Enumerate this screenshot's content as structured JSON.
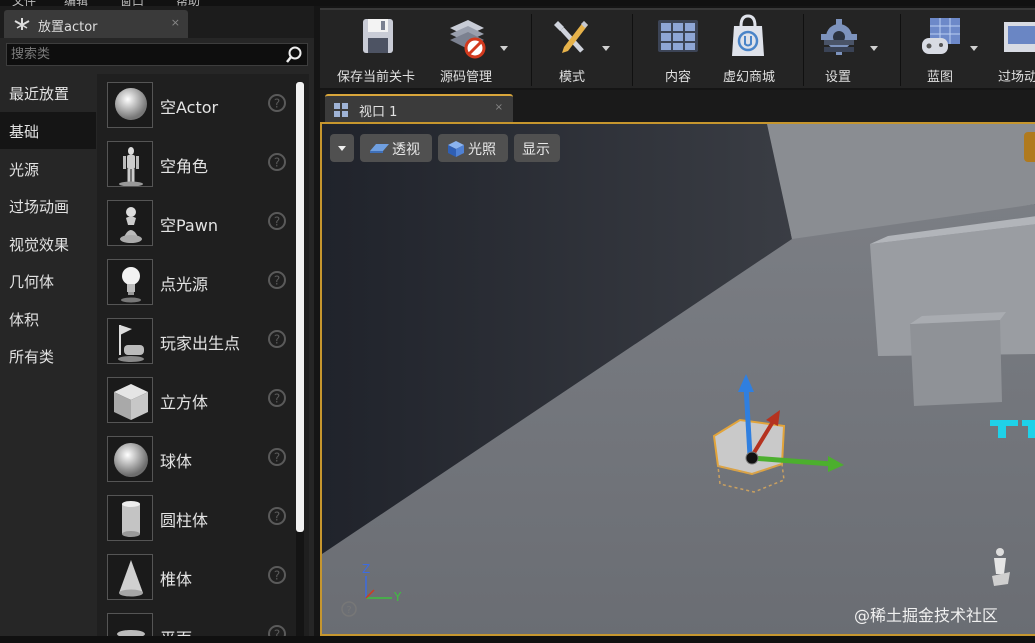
{
  "top_menu": [
    "文件",
    "编辑",
    "窗口",
    "帮助"
  ],
  "panel": {
    "title": "放置actor",
    "close": "×",
    "search_placeholder": "搜索类",
    "categories": [
      "最近放置",
      "基础",
      "光源",
      "过场动画",
      "视觉效果",
      "几何体",
      "体积",
      "所有类"
    ],
    "active_category": "基础",
    "items": [
      {
        "label": "空Actor",
        "icon": "sphere-icon"
      },
      {
        "label": "空角色",
        "icon": "character-icon"
      },
      {
        "label": "空Pawn",
        "icon": "pawn-icon"
      },
      {
        "label": "点光源",
        "icon": "light-bulb-icon"
      },
      {
        "label": "玩家出生点",
        "icon": "player-start-icon"
      },
      {
        "label": "立方体",
        "icon": "cube-icon"
      },
      {
        "label": "球体",
        "icon": "sphere-icon"
      },
      {
        "label": "圆柱体",
        "icon": "cylinder-icon"
      },
      {
        "label": "椎体",
        "icon": "cone-icon"
      },
      {
        "label": "平面",
        "icon": "plane-icon"
      }
    ]
  },
  "toolbar": {
    "save": "保存当前关卡",
    "source": "源码管理",
    "modes": "模式",
    "content": "内容",
    "market": "虚幻商城",
    "settings": "设置",
    "blueprints": "蓝图",
    "cinematics": "过场动"
  },
  "viewport": {
    "tab_title": "视口 1",
    "tab_close": "×",
    "perspective": "透视",
    "lit": "光照",
    "show": "显示",
    "axis_z": "Z",
    "axis_y": "Y",
    "watermark": "@稀土掘金技术社区"
  },
  "colors": {
    "accent_orange": "#c6962e",
    "gizmo_x": "#c0392b",
    "gizmo_y": "#4caf2e",
    "gizmo_z": "#2f7fe0"
  }
}
